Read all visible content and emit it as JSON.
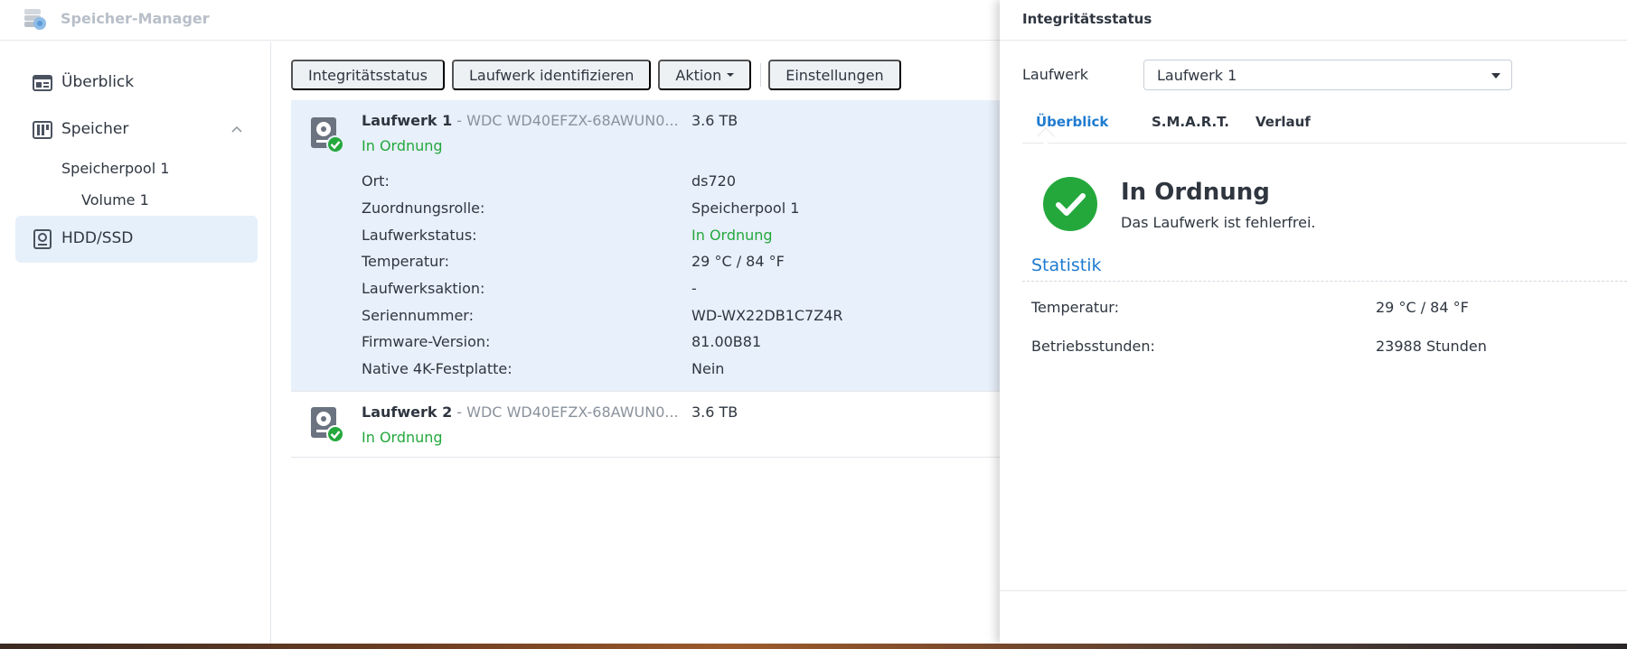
{
  "app": {
    "title": "Speicher-Manager"
  },
  "sidebar": {
    "items": [
      {
        "label": "Überblick",
        "icon": "overview-icon"
      },
      {
        "label": "Speicher",
        "icon": "storage-icon",
        "expanded": true
      },
      {
        "label": "HDD/SSD",
        "icon": "drive-icon",
        "active": true
      }
    ],
    "sub_items": [
      {
        "label": "Speicherpool 1"
      },
      {
        "label": "Volume 1"
      }
    ]
  },
  "toolbar": {
    "health_label": "Integritätsstatus",
    "identify_label": "Laufwerk identifizieren",
    "action_label": "Aktion",
    "settings_label": "Einstellungen"
  },
  "drives": [
    {
      "name": "Laufwerk 1",
      "model": " - WDC WD40EFZX-68AWUN0...",
      "size": "3.6 TB",
      "status": "In Ordnung",
      "details": [
        {
          "label": "Ort:",
          "value": "ds720"
        },
        {
          "label": "Zuordnungsrolle:",
          "value": "Speicherpool 1"
        },
        {
          "label": "Laufwerkstatus:",
          "value": "In Ordnung"
        },
        {
          "label": "Temperatur:",
          "value": "29 °C / 84 °F"
        },
        {
          "label": "Laufwerksaktion:",
          "value": "-"
        },
        {
          "label": "Seriennummer:",
          "value": "WD-WX22DB1C7Z4R"
        },
        {
          "label": "Firmware-Version:",
          "value": "81.00B81"
        },
        {
          "label": "Native 4K-Festplatte:",
          "value": "Nein"
        }
      ]
    },
    {
      "name": "Laufwerk 2",
      "model": " - WDC WD40EFZX-68AWUN0...",
      "size": "3.6 TB",
      "status": "In Ordnung"
    }
  ],
  "panel": {
    "title": "Integritätsstatus",
    "drive_label": "Laufwerk",
    "drive_selected": "Laufwerk 1",
    "tabs": [
      {
        "label": "Überblick",
        "active": true
      },
      {
        "label": "S.M.A.R.T."
      },
      {
        "label": "Verlauf"
      }
    ],
    "status_title": "In Ordnung",
    "status_desc": "Das Laufwerk ist fehlerfrei.",
    "section_title": "Statistik",
    "stats": [
      {
        "label": "Temperatur:",
        "value": "29 °C / 84 °F"
      },
      {
        "label": "Betriebsstunden:",
        "value": "23988 Stunden"
      }
    ]
  },
  "colors": {
    "accent": "#1e7bd0",
    "ok_green": "#24a83c",
    "selected_bg": "#e8f0fb",
    "sidebar_active_bg": "#e6f0fb"
  }
}
